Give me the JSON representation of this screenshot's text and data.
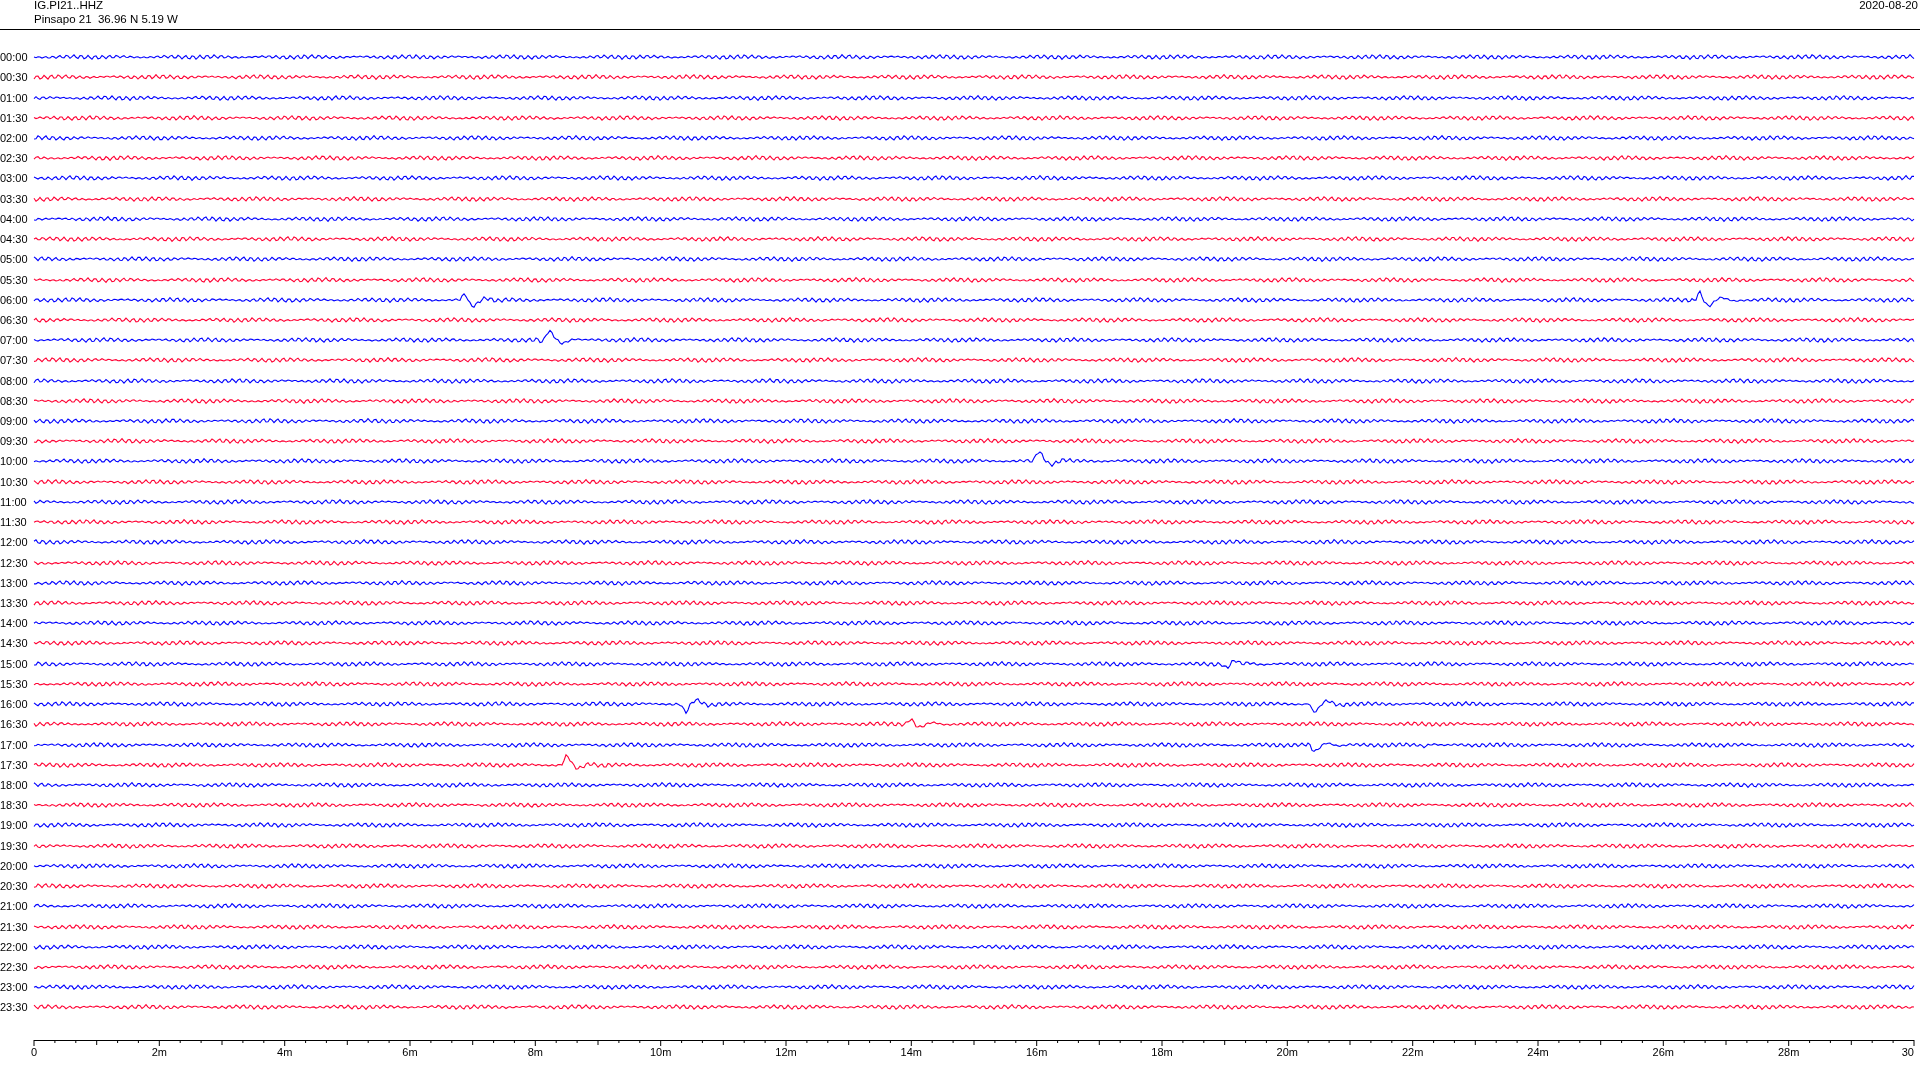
{
  "header": {
    "station": "IG.PI21..HHZ",
    "location": "Pinsapo 21  36.96 N 5.19 W",
    "date": "2020-08-20"
  },
  "rows": [
    {
      "label": "00:00",
      "color": "#0000ff"
    },
    {
      "label": "00:30",
      "color": "#ff0033"
    },
    {
      "label": "01:00",
      "color": "#0000ff"
    },
    {
      "label": "01:30",
      "color": "#ff0033"
    },
    {
      "label": "02:00",
      "color": "#0000ff"
    },
    {
      "label": "02:30",
      "color": "#ff0033"
    },
    {
      "label": "03:00",
      "color": "#0000ff"
    },
    {
      "label": "03:30",
      "color": "#ff0033"
    },
    {
      "label": "04:00",
      "color": "#0000ff"
    },
    {
      "label": "04:30",
      "color": "#ff0033"
    },
    {
      "label": "05:00",
      "color": "#0000ff"
    },
    {
      "label": "05:30",
      "color": "#ff0033"
    },
    {
      "label": "06:00",
      "color": "#0000ff"
    },
    {
      "label": "06:30",
      "color": "#ff0033"
    },
    {
      "label": "07:00",
      "color": "#0000ff"
    },
    {
      "label": "07:30",
      "color": "#ff0033"
    },
    {
      "label": "08:00",
      "color": "#0000ff"
    },
    {
      "label": "08:30",
      "color": "#ff0033"
    },
    {
      "label": "09:00",
      "color": "#0000ff"
    },
    {
      "label": "09:30",
      "color": "#ff0033"
    },
    {
      "label": "10:00",
      "color": "#0000ff"
    },
    {
      "label": "10:30",
      "color": "#ff0033"
    },
    {
      "label": "11:00",
      "color": "#0000ff"
    },
    {
      "label": "11:30",
      "color": "#ff0033"
    },
    {
      "label": "12:00",
      "color": "#0000ff"
    },
    {
      "label": "12:30",
      "color": "#ff0033"
    },
    {
      "label": "13:00",
      "color": "#0000ff"
    },
    {
      "label": "13:30",
      "color": "#ff0033"
    },
    {
      "label": "14:00",
      "color": "#0000ff"
    },
    {
      "label": "14:30",
      "color": "#ff0033"
    },
    {
      "label": "15:00",
      "color": "#0000ff"
    },
    {
      "label": "15:30",
      "color": "#ff0033"
    },
    {
      "label": "16:00",
      "color": "#0000ff"
    },
    {
      "label": "16:30",
      "color": "#ff0033"
    },
    {
      "label": "17:00",
      "color": "#0000ff"
    },
    {
      "label": "17:30",
      "color": "#ff0033"
    },
    {
      "label": "18:00",
      "color": "#0000ff"
    },
    {
      "label": "18:30",
      "color": "#ff0033"
    },
    {
      "label": "19:00",
      "color": "#0000ff"
    },
    {
      "label": "19:30",
      "color": "#ff0033"
    },
    {
      "label": "20:00",
      "color": "#0000ff"
    },
    {
      "label": "20:30",
      "color": "#ff0033"
    },
    {
      "label": "21:00",
      "color": "#0000ff"
    },
    {
      "label": "21:30",
      "color": "#ff0033"
    },
    {
      "label": "22:00",
      "color": "#0000ff"
    },
    {
      "label": "22:30",
      "color": "#ff0033"
    },
    {
      "label": "23:00",
      "color": "#0000ff"
    },
    {
      "label": "23:30",
      "color": "#ff0033"
    }
  ],
  "x_axis": {
    "tick_labels": [
      "0",
      "2m",
      "4m",
      "6m",
      "8m",
      "10m",
      "12m",
      "14m",
      "16m",
      "18m",
      "20m",
      "22m",
      "24m",
      "26m",
      "28m",
      "30"
    ]
  }
}
